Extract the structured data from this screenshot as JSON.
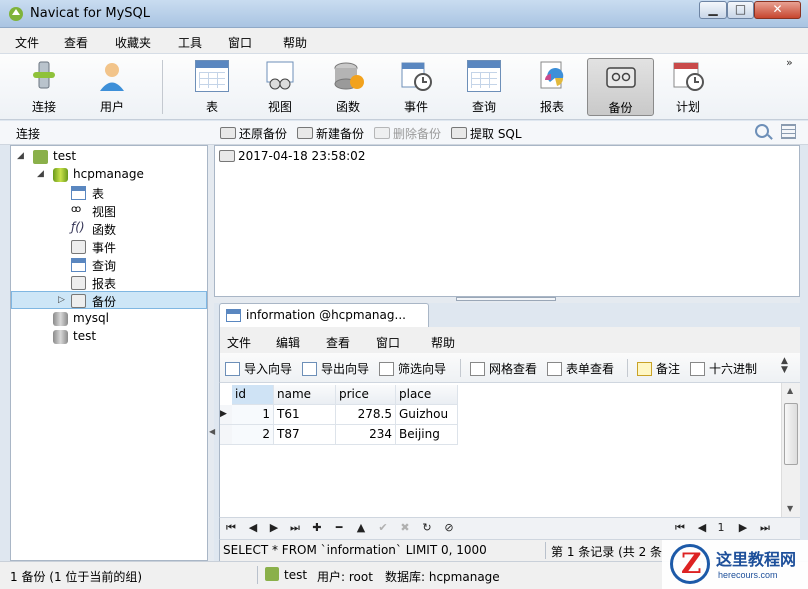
{
  "window": {
    "title": "Navicat for MySQL",
    "btn_min": "▁",
    "btn_max": "□",
    "btn_close": "✕"
  },
  "menu": [
    "文件",
    "查看",
    "收藏夹",
    "工具",
    "窗口",
    "帮助"
  ],
  "toolbar": {
    "items": [
      {
        "label": "连接",
        "icon": "connection-icon"
      },
      {
        "label": "用户",
        "icon": "user-icon"
      },
      {
        "label": "表",
        "icon": "table-icon"
      },
      {
        "label": "视图",
        "icon": "view-icon"
      },
      {
        "label": "函数",
        "icon": "function-icon"
      },
      {
        "label": "事件",
        "icon": "event-icon"
      },
      {
        "label": "查询",
        "icon": "query-icon"
      },
      {
        "label": "报表",
        "icon": "report-icon"
      },
      {
        "label": "备份",
        "icon": "backup-icon",
        "active": true
      },
      {
        "label": "计划",
        "icon": "schedule-icon"
      }
    ],
    "more": "»"
  },
  "left_header": "连接",
  "object_toolbar": {
    "restore": "还原备份",
    "new": "新建备份",
    "delete": "删除备份",
    "extract": "提取 SQL"
  },
  "tree": [
    {
      "label": "test",
      "level": 0,
      "expanded": true
    },
    {
      "label": "hcpmanage",
      "level": 1,
      "expanded": true
    },
    {
      "label": "表",
      "level": 2
    },
    {
      "label": "视图",
      "level": 2
    },
    {
      "label": "函数",
      "level": 2
    },
    {
      "label": "事件",
      "level": 2
    },
    {
      "label": "查询",
      "level": 2
    },
    {
      "label": "报表",
      "level": 2
    },
    {
      "label": "备份",
      "level": 2,
      "selected": true
    },
    {
      "label": "mysql",
      "level": 1
    },
    {
      "label": "test",
      "level": 1
    }
  ],
  "backups": [
    "2017-04-18 23:58:02"
  ],
  "table_window": {
    "tab_title": "information @hcpmanag...",
    "menu": [
      "文件",
      "编辑",
      "查看",
      "窗口",
      "帮助"
    ],
    "toolbar": {
      "import": "导入向导",
      "export": "导出向导",
      "filter": "筛选向导",
      "grid_view": "网格查看",
      "form_view": "表单查看",
      "memo": "备注",
      "hex": "十六进制"
    },
    "columns": [
      "id",
      "name",
      "price",
      "place"
    ],
    "rows": [
      [
        "1",
        "T61",
        "278.5",
        "Guizhou"
      ],
      [
        "2",
        "T87",
        "234",
        "Beijing"
      ]
    ],
    "nav": {
      "first": "⏮",
      "prev": "◀",
      "next": "▶",
      "last": "⏭",
      "add": "✚",
      "delete": "━",
      "up": "▲",
      "apply": "✔",
      "cancel": "✖",
      "refresh": "↻",
      "stop": "⊘"
    },
    "sql": "SELECT * FROM `information` LIMIT 0, 1000",
    "record_info": "第 1 条记录 (共 2 条"
  },
  "status": {
    "left": "1 备份 (1 位于当前的组)",
    "connection": "test",
    "user": "用户: root",
    "database": "数据库: hcpmanage"
  },
  "watermark": {
    "cn": "这里教程网",
    "en": "herecours.com",
    "logo": "Z"
  }
}
